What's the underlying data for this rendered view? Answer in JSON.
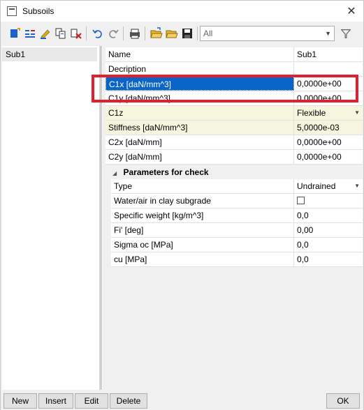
{
  "window": {
    "title": "Subsoils",
    "close_glyph": "✕"
  },
  "toolbar": {
    "icons": [
      "add-icon",
      "insert-icon",
      "edit-icon",
      "copy-icon",
      "delete-icon",
      "undo-icon",
      "redo-icon",
      "print-icon",
      "open-folder-icon",
      "open-folder-icon",
      "save-icon"
    ],
    "filter_value": "All",
    "filter_glyph": "⊽"
  },
  "list": {
    "items": [
      {
        "label": "Sub1"
      }
    ]
  },
  "properties": {
    "rows": [
      {
        "name": "Name",
        "value": "Sub1"
      },
      {
        "name": "Decription",
        "value": ""
      },
      {
        "name": "C1x [daN/mm^3]",
        "value": "0,0000e+00"
      },
      {
        "name": "C1y [daN/mm^3]",
        "value": "0,0000e+00"
      },
      {
        "name": "C1z",
        "value": "Flexible"
      },
      {
        "name": "Stiffness [daN/mm^3]",
        "value": "5,0000e-03"
      },
      {
        "name": "C2x [daN/mm]",
        "value": "0,0000e+00"
      },
      {
        "name": "C2y [daN/mm]",
        "value": "0,0000e+00"
      }
    ],
    "section": {
      "title": "Parameters for check",
      "rows": [
        {
          "name": "Type",
          "value": "Undrained"
        },
        {
          "name": "Water/air in clay subgrade",
          "value": ""
        },
        {
          "name": "Specific weight [kg/m^3]",
          "value": "0,0"
        },
        {
          "name": "Fi' [deg]",
          "value": "0,00"
        },
        {
          "name": "Sigma oc [MPa]",
          "value": "0,0"
        },
        {
          "name": "cu [MPa]",
          "value": "0,0"
        }
      ]
    }
  },
  "buttons": {
    "new": "New",
    "insert": "Insert",
    "edit": "Edit",
    "delete": "Delete",
    "ok": "OK"
  },
  "colors": {
    "selection": "#0a64c8",
    "highlight_border": "#e0202c",
    "yellow_row": "#f5f6dd"
  }
}
